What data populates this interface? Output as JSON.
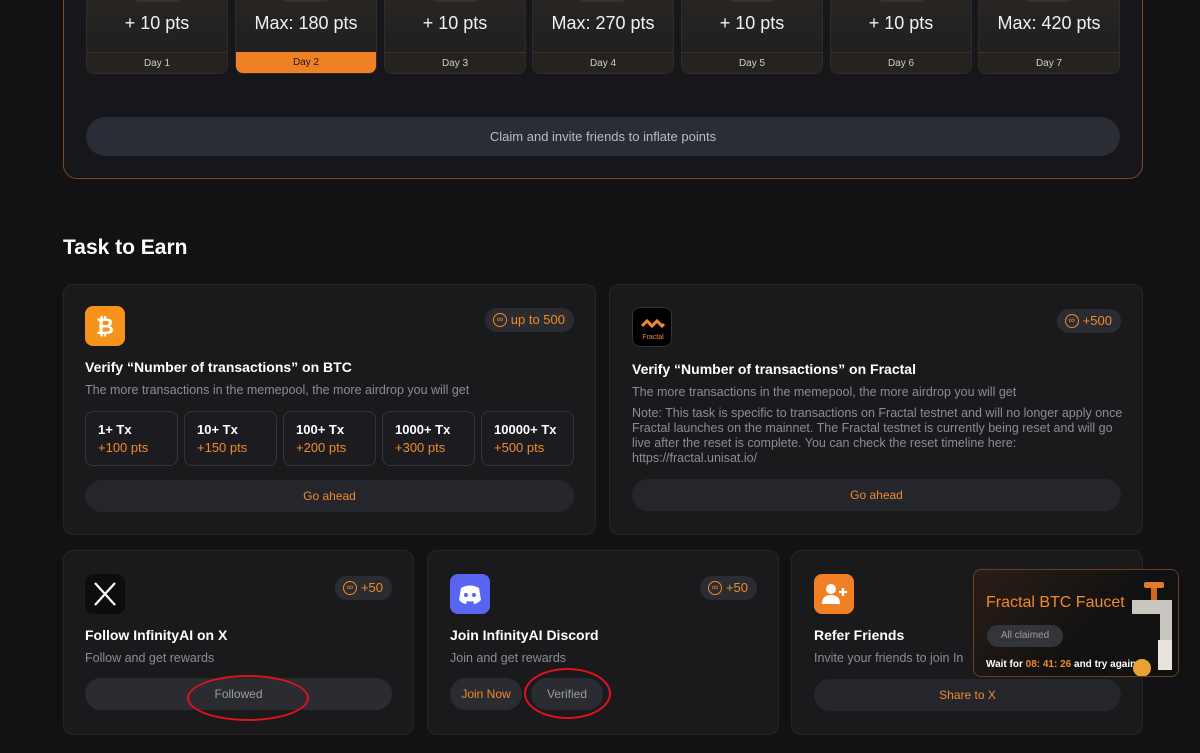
{
  "checkin": {
    "days": [
      {
        "points": "+ 10 pts",
        "label": "Day 1",
        "active": false
      },
      {
        "points": "Max: 180 pts",
        "label": "Day 2",
        "active": true
      },
      {
        "points": "+ 10 pts",
        "label": "Day 3",
        "active": false
      },
      {
        "points": "Max: 270 pts",
        "label": "Day 4",
        "active": false
      },
      {
        "points": "+ 10 pts",
        "label": "Day 5",
        "active": false
      },
      {
        "points": "+ 10 pts",
        "label": "Day 6",
        "active": false
      },
      {
        "points": "Max: 420 pts",
        "label": "Day 7",
        "active": false
      }
    ],
    "claim_label": "Claim and invite friends to inflate points"
  },
  "tasks": {
    "title": "Task to Earn",
    "btc": {
      "badge": "up to 500",
      "title": "Verify “Number of transactions” on BTC",
      "desc": "The more transactions in the memepool, the more airdrop you will get",
      "tiers": [
        {
          "tx": "1+ Tx",
          "pts": "+100 pts"
        },
        {
          "tx": "10+ Tx",
          "pts": "+150 pts"
        },
        {
          "tx": "100+ Tx",
          "pts": "+200 pts"
        },
        {
          "tx": "1000+ Tx",
          "pts": "+300 pts"
        },
        {
          "tx": "10000+ Tx",
          "pts": "+500 pts"
        }
      ],
      "button": "Go ahead"
    },
    "fractal": {
      "badge": "+500",
      "logo_text": "Fractal",
      "title": "Verify “Number of transactions” on Fractal",
      "desc": "The more transactions in the memepool, the more airdrop you will get",
      "note": "Note: This task is specific to transactions on Fractal testnet and will no longer apply once Fractal launches on the mainnet. The Fractal testnet is currently being reset and will go live after the reset is complete. You can check the reset timeline here: https://fractal.unisat.io/",
      "button": "Go ahead"
    },
    "x": {
      "badge": "+50",
      "title": "Follow InfinityAI on X",
      "desc": "Follow and get rewards",
      "button": "Followed"
    },
    "discord": {
      "badge": "+50",
      "title": "Join InfinityAI Discord",
      "desc": "Join and get rewards",
      "join_button": "Join Now",
      "verified_button": "Verified"
    },
    "refer": {
      "title": "Refer Friends",
      "desc": "Invite your friends to join In",
      "button": "Share to X"
    }
  },
  "faucet": {
    "title": "Fractal BTC Faucet",
    "status": "All claimed",
    "wait_prefix": "Wait for",
    "time": "08: 41: 26",
    "wait_suffix": "and try again"
  },
  "colors": {
    "accent": "#f08024",
    "annotation": "#e0121b"
  }
}
